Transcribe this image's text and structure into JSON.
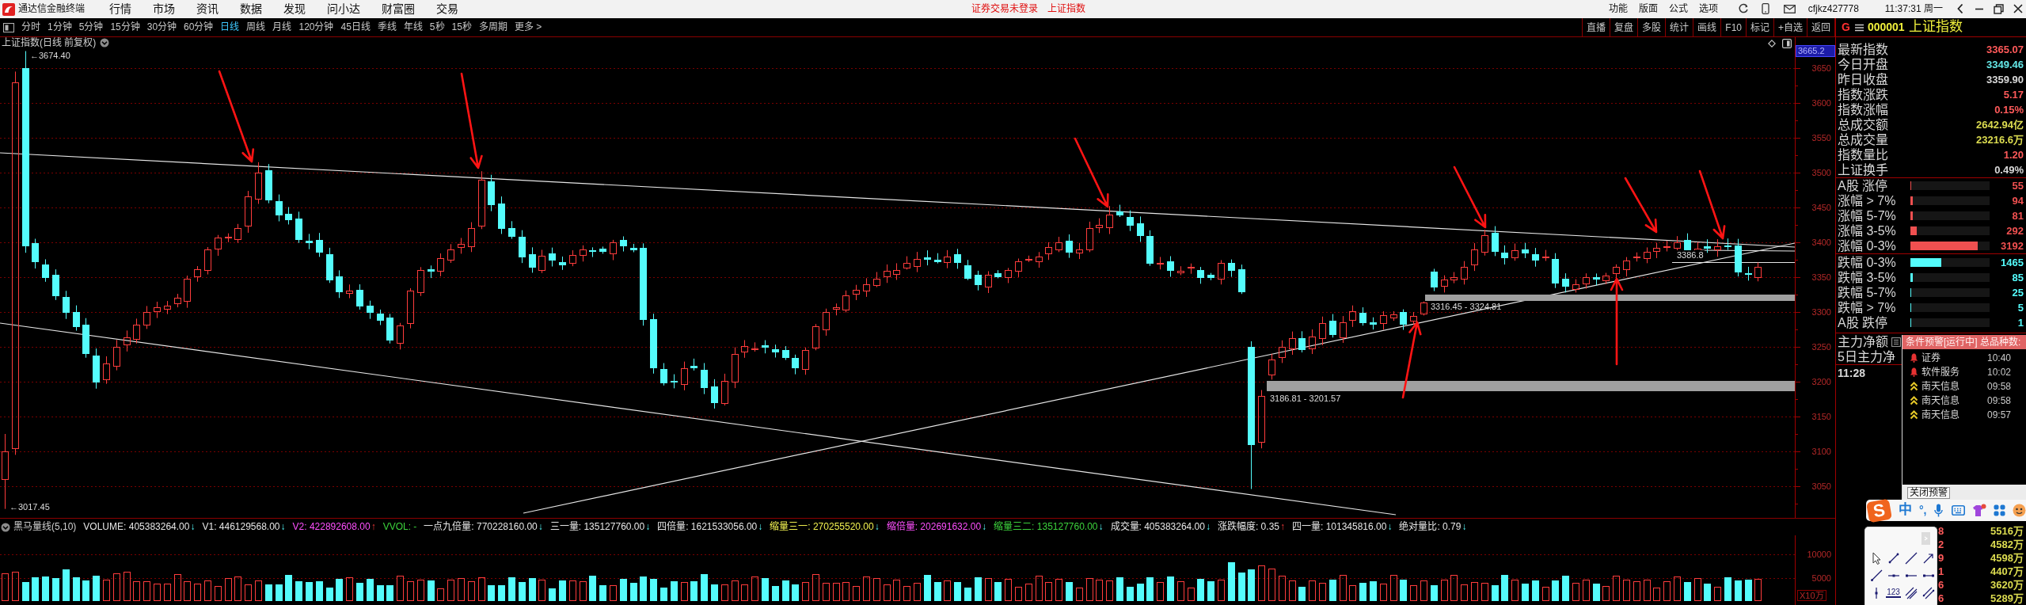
{
  "title_bar": {
    "app_name": "通达信金融终端",
    "menu": [
      "行情",
      "市场",
      "资讯",
      "数据",
      "发现",
      "问小达",
      "财富圈",
      "交易"
    ],
    "notices": [
      "证券交易未登录",
      "上证指数"
    ],
    "functions": [
      "功能",
      "版面",
      "公式",
      "选项"
    ],
    "account": "cfjkz427778",
    "clock": "11:37:31 周一"
  },
  "period_bar": {
    "periods": [
      {
        "label": "分时",
        "selected": false
      },
      {
        "label": "1分钟",
        "selected": false
      },
      {
        "label": "5分钟",
        "selected": false
      },
      {
        "label": "15分钟",
        "selected": false
      },
      {
        "label": "30分钟",
        "selected": false
      },
      {
        "label": "60分钟",
        "selected": false
      },
      {
        "label": "日线",
        "selected": true
      },
      {
        "label": "周线",
        "selected": false
      },
      {
        "label": "月线",
        "selected": false
      },
      {
        "label": "120分钟",
        "selected": false
      },
      {
        "label": "45日线",
        "selected": false
      },
      {
        "label": "季线",
        "selected": false
      },
      {
        "label": "年线",
        "selected": false
      },
      {
        "label": "5秒",
        "selected": false
      },
      {
        "label": "15秒",
        "selected": false
      },
      {
        "label": "多周期",
        "selected": false
      },
      {
        "label": "更多 >",
        "selected": false
      }
    ],
    "tools": [
      "直播",
      "复盘",
      "多股",
      "统计",
      "画线",
      "F10",
      "标记",
      "+自选",
      "返回"
    ]
  },
  "chart": {
    "title": "上证指数(日线 前复权)",
    "cursor_price": "3665.2",
    "price_ticks": [
      "3650",
      "3600",
      "3550",
      "3500",
      "3450",
      "3400",
      "3350",
      "3300",
      "3250",
      "3200",
      "3150",
      "3100",
      "3050"
    ],
    "marks": [
      {
        "kind": "high",
        "text": "←3674.40"
      },
      {
        "kind": "low",
        "text": "←3017.45"
      },
      {
        "kind": "gap",
        "text": "3316.45 - 3324.81"
      },
      {
        "kind": "gap",
        "text": "3186.81 - 3201.57"
      },
      {
        "kind": "line",
        "text": "3386.8"
      }
    ]
  },
  "indicator": {
    "name": "黑马量线(5,10)",
    "values": [
      {
        "text": "VOLUME: 405383264.00",
        "color": "#e6e6e6",
        "arrow": "↓",
        "rising": false
      },
      {
        "text": "V1: 446129568.00",
        "color": "#e6e6e6",
        "arrow": "↓",
        "rising": false
      },
      {
        "text": "V2: 422892608.00",
        "color": "#ff50ff",
        "arrow": "↑",
        "rising": true
      },
      {
        "text": "VVOL: -",
        "color": "#3cd23c"
      },
      {
        "text": "一点九倍量: 770228160.00",
        "color": "#e6e6e6",
        "arrow": "↓",
        "rising": false
      },
      {
        "text": "三一量: 135127760.00",
        "color": "#e6e6e6",
        "arrow": "↓",
        "rising": false
      },
      {
        "text": "四倍量: 1621533056.00",
        "color": "#e6e6e6",
        "arrow": "↓",
        "rising": false
      },
      {
        "text": "缩量三一: 270255520.00",
        "color": "#f0f050",
        "arrow": "↓",
        "rising": false
      },
      {
        "text": "缩倍量: 202691632.00",
        "color": "#ff50ff",
        "arrow": "↓",
        "rising": false
      },
      {
        "text": "缩量三二: 135127760.00",
        "color": "#3cd23c",
        "arrow": "↓",
        "rising": false
      },
      {
        "text": "成交量: 405383264.00",
        "color": "#e6e6e6",
        "arrow": "↓",
        "rising": false
      },
      {
        "text": "涨跌幅度: 0.35",
        "color": "#e6e6e6",
        "arrow": "↑",
        "rising": true
      },
      {
        "text": "四一量: 101345816.00",
        "color": "#e6e6e6",
        "arrow": "↓",
        "rising": false
      },
      {
        "text": "绝对量比: 0.79",
        "color": "#e6e6e6",
        "arrow": "↓",
        "rising": false
      }
    ]
  },
  "volume": {
    "ticks": [
      "10000",
      "5000"
    ],
    "unit": "X10万"
  },
  "quote_panel": {
    "market": "G",
    "code": "000001",
    "name": "上证指数",
    "rows": [
      {
        "label": "最新指数",
        "value": "3365.07",
        "color": "#ff5a5a"
      },
      {
        "label": "今日开盘",
        "value": "3349.46",
        "color": "#64e6e6"
      },
      {
        "label": "昨日收盘",
        "value": "3359.90",
        "color": "#d8d8d8"
      },
      {
        "label": "指数涨跌",
        "value": "5.17",
        "color": "#ff5a5a"
      },
      {
        "label": "指数涨幅",
        "value": "0.15%",
        "color": "#ff5a5a"
      },
      {
        "label": "总成交额",
        "value": "2642.94亿",
        "color": "#dcdc50"
      },
      {
        "label": "总成交量",
        "value": "23216.6万",
        "color": "#dcdc50"
      },
      {
        "label": "指数量比",
        "value": "1.20",
        "color": "#ff5a5a"
      },
      {
        "label": "上证换手",
        "value": "0.49%",
        "color": "#d8d8d8"
      }
    ]
  },
  "breadth": {
    "rising": [
      {
        "label": "A股 涨停",
        "count": "55",
        "level": 0.01
      },
      {
        "label": "涨幅 > 7%",
        "count": "94",
        "level": 0.03
      },
      {
        "label": "涨幅 5-7%",
        "count": "81",
        "level": 0.03
      },
      {
        "label": "涨幅 3-5%",
        "count": "292",
        "level": 0.08
      },
      {
        "label": "涨幅 0-3%",
        "count": "3192",
        "level": 0.85
      }
    ],
    "falling": [
      {
        "label": "跌幅 0-3%",
        "count": "1465",
        "level": 0.39
      },
      {
        "label": "跌幅 3-5%",
        "count": "85",
        "level": 0.03
      },
      {
        "label": "跌幅 5-7%",
        "count": "25",
        "level": 0.01
      },
      {
        "label": "跌幅 > 7%",
        "count": "5",
        "level": 0.01
      },
      {
        "label": "A股 跌停",
        "count": "1",
        "level": 0.01
      }
    ]
  },
  "fund_flow": {
    "rows": [
      "主力净额",
      "5日主力净"
    ],
    "time": "11:28"
  },
  "alert_popup": {
    "title": "条件预警[运行中] 总品种数:",
    "items": [
      {
        "kind": "bell",
        "name": "证券",
        "time": "10:40"
      },
      {
        "kind": "bell",
        "name": "软件服务",
        "time": "10:02"
      },
      {
        "kind": "rise",
        "name": "南天信息",
        "time": "09:58"
      },
      {
        "kind": "rise",
        "name": "南天信息",
        "time": "09:58"
      },
      {
        "kind": "rise",
        "name": "南天信息",
        "time": "09:57"
      }
    ],
    "close_button": "关闭预警"
  },
  "ranking": {
    "rows": [
      {
        "column_1": "8",
        "column_2": "5516万"
      },
      {
        "column_1": "2",
        "column_2": "4582万"
      },
      {
        "column_1": "9",
        "column_2": "4598万"
      },
      {
        "column_1": "1",
        "column_2": "4407万"
      },
      {
        "column_1": "6",
        "column_2": "3620万"
      },
      {
        "column_1": "6",
        "column_2": "5289万"
      }
    ]
  },
  "ime_bar": {
    "logo_letter": "S",
    "mode": "中",
    "punctuation": "°,"
  },
  "draw_tools": {
    "label_tool": "123"
  }
}
